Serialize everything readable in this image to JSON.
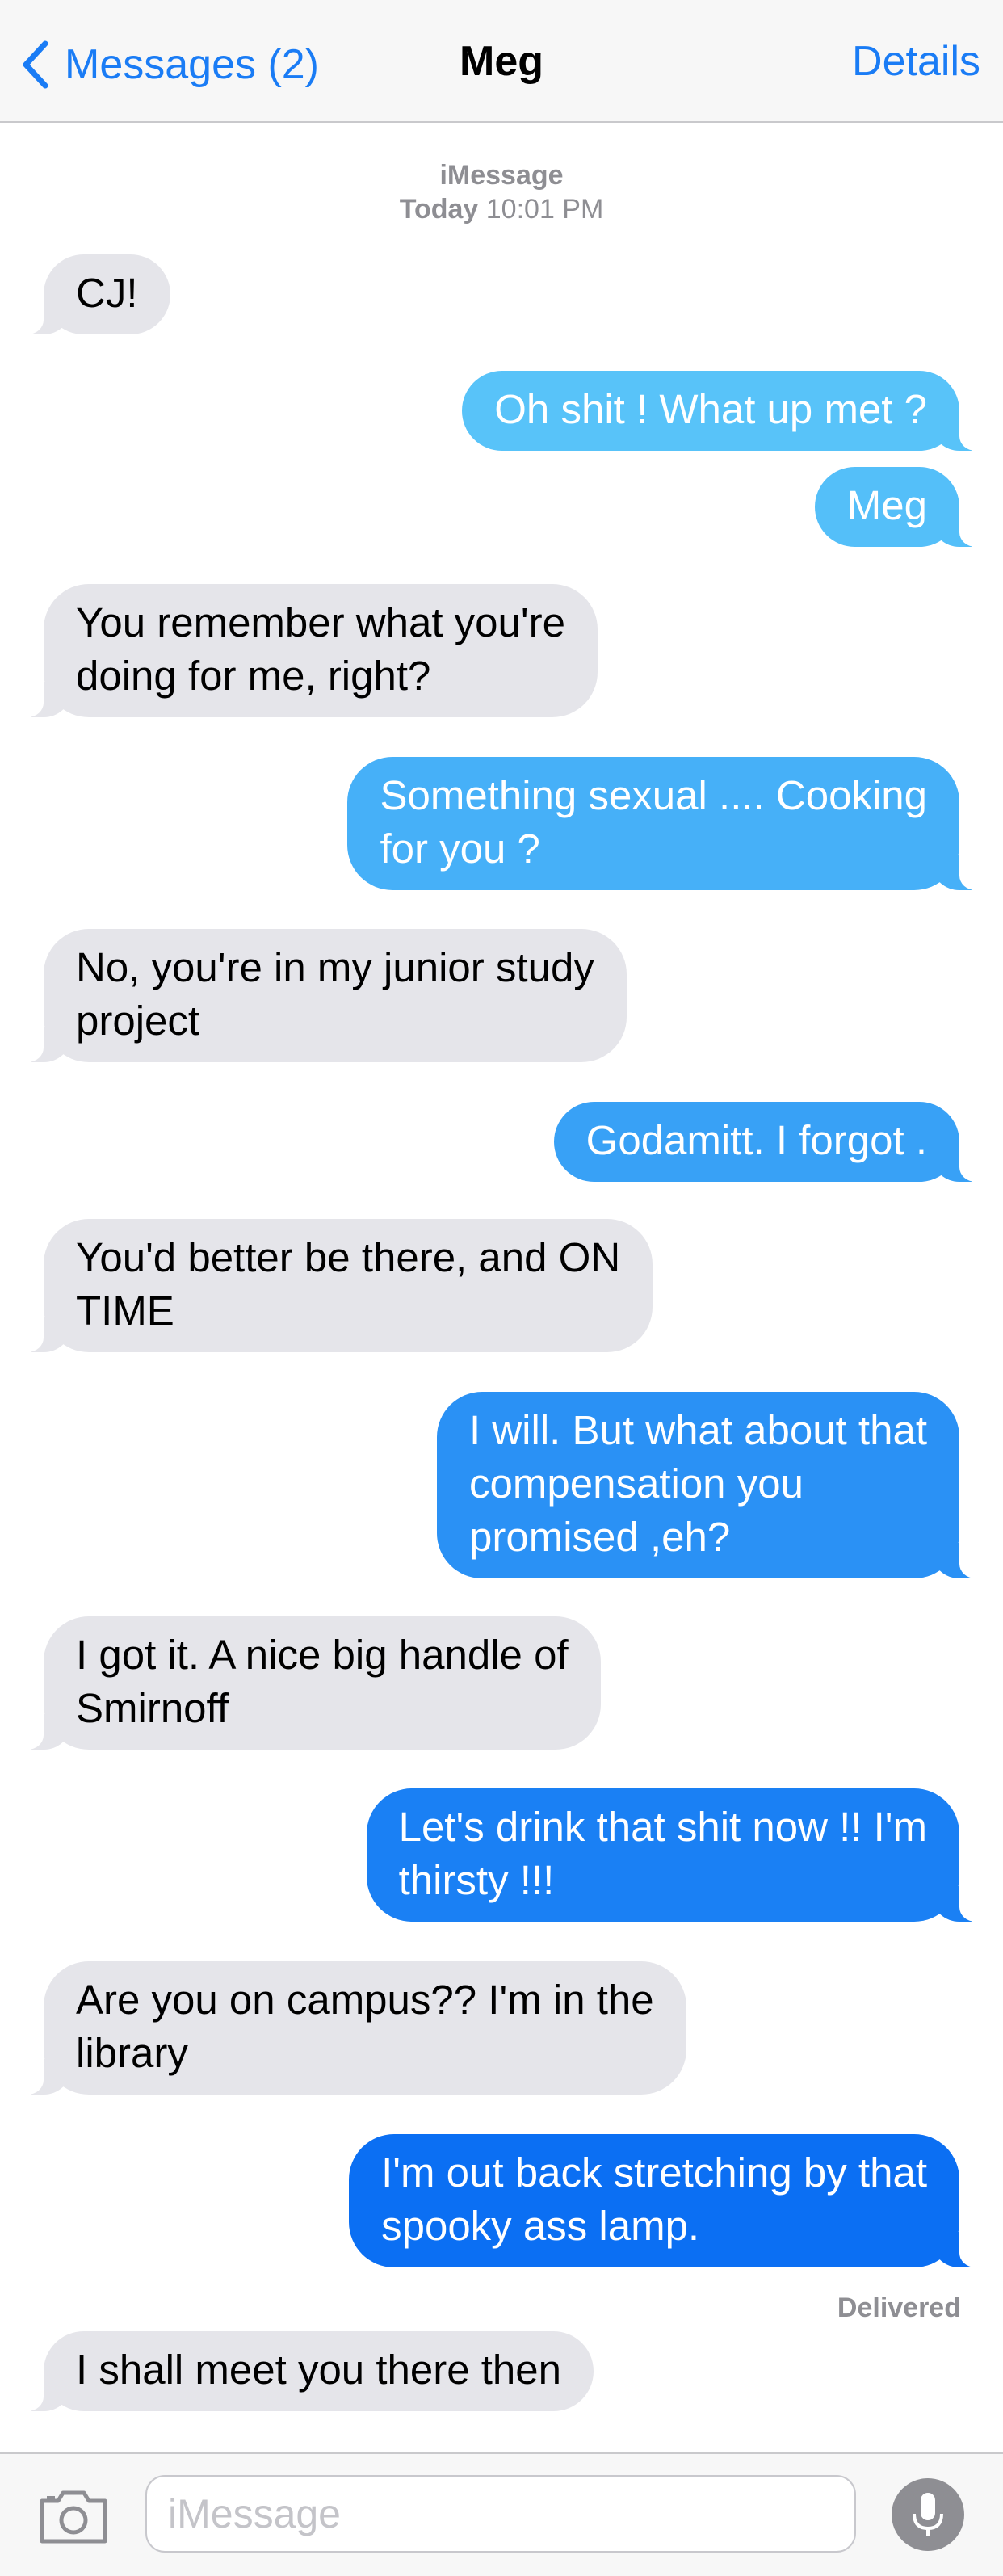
{
  "nav": {
    "back_label": "Messages (2)",
    "title": "Meg",
    "details_label": "Details"
  },
  "conversation": {
    "service": "iMessage",
    "day": "Today",
    "time": "10:01 PM"
  },
  "messages": [
    {
      "from": "contact",
      "lines": [
        "CJ!"
      ]
    },
    {
      "from": "me",
      "lines": [
        "Oh shit ! What up met ?"
      ]
    },
    {
      "from": "me",
      "lines": [
        "Meg"
      ]
    },
    {
      "from": "contact",
      "lines": [
        "You remember what you're",
        "doing for me, right?"
      ]
    },
    {
      "from": "me",
      "lines": [
        "Something sexual .... Cooking",
        "for you ?"
      ]
    },
    {
      "from": "contact",
      "lines": [
        "No, you're in my junior study",
        "project"
      ]
    },
    {
      "from": "me",
      "lines": [
        "Godamitt. I forgot ."
      ]
    },
    {
      "from": "contact",
      "lines": [
        "You'd better be there, and ON",
        "TIME"
      ]
    },
    {
      "from": "me",
      "lines": [
        "I will. But what about that",
        "compensation you",
        "promised ,eh?"
      ]
    },
    {
      "from": "contact",
      "lines": [
        "I got it. A nice big handle of",
        "Smirnoff"
      ]
    },
    {
      "from": "me",
      "lines": [
        "Let's drink that shit now !! I'm",
        "thirsty !!!"
      ]
    },
    {
      "from": "contact",
      "lines": [
        "Are you on campus?? I'm in the",
        "library"
      ]
    },
    {
      "from": "me",
      "lines": [
        "I'm out back stretching by that",
        "spooky ass lamp."
      ]
    },
    {
      "from": "contact",
      "lines": [
        "I shall meet you there then"
      ]
    }
  ],
  "status": {
    "delivered": "Delivered"
  },
  "input": {
    "placeholder": "iMessage"
  },
  "icons": {
    "back": "chevron-left-icon",
    "camera": "camera-icon",
    "mic": "microphone-icon"
  },
  "colors": {
    "accent": "#1a7cf5",
    "incoming_bubble": "#e5e5ea",
    "outgoing_gradient_top": "#5ac6f9",
    "outgoing_gradient_bottom": "#0a6ef3"
  }
}
